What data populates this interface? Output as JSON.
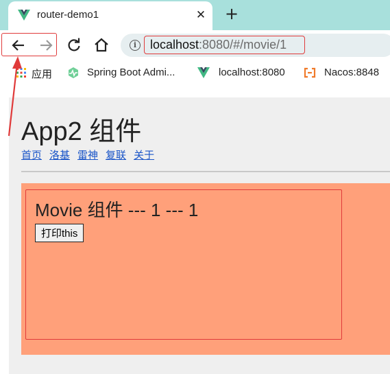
{
  "browser": {
    "tab": {
      "title": "router-demo1",
      "favicon": "vue-logo-icon",
      "close": "✕"
    },
    "new_tab": "+",
    "toolbar": {
      "back": "arrow-left-icon",
      "forward": "arrow-right-icon",
      "reload": "reload-icon",
      "home": "home-icon",
      "info": "i",
      "url_host": "localhost",
      "url_rest": ":8080/#/movie/1"
    },
    "bookmarks": [
      {
        "label": "应用",
        "icon": "apps-grid-icon"
      },
      {
        "label": "Spring Boot Admi...",
        "icon": "spring-boot-admin-icon"
      },
      {
        "label": "localhost:8080",
        "icon": "vue-logo-icon"
      },
      {
        "label": "Nacos:8848",
        "icon": "nacos-icon"
      }
    ]
  },
  "page": {
    "app_title": "App2 组件",
    "nav_links": [
      "首页",
      "洛基",
      "雷神",
      "复联",
      "关于"
    ],
    "movie": {
      "title": "Movie 组件 --- 1 --- 1",
      "button": "打印this"
    }
  },
  "colors": {
    "tab_strip": "#a8e0dc",
    "annotation": "#e03a3a",
    "movie_background": "#ffa07a",
    "link": "#1a55c8"
  }
}
